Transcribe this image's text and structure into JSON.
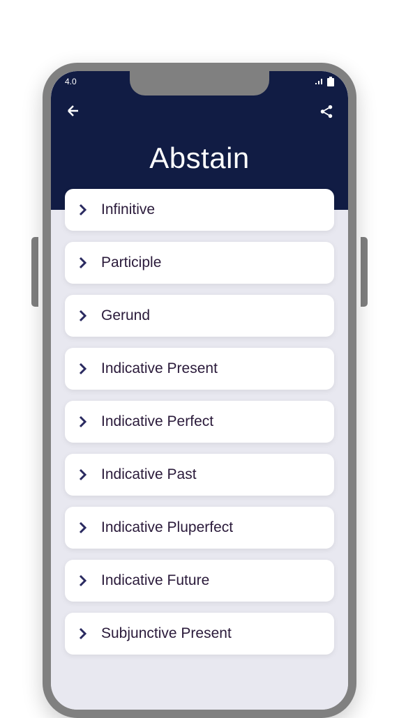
{
  "status": {
    "time": "4.0"
  },
  "header": {
    "title": "Abstain"
  },
  "items": [
    {
      "label": "Infinitive"
    },
    {
      "label": "Participle"
    },
    {
      "label": "Gerund"
    },
    {
      "label": "Indicative Present"
    },
    {
      "label": "Indicative Perfect"
    },
    {
      "label": "Indicative Past"
    },
    {
      "label": "Indicative Pluperfect"
    },
    {
      "label": "Indicative Future"
    },
    {
      "label": "Subjunctive Present"
    }
  ]
}
